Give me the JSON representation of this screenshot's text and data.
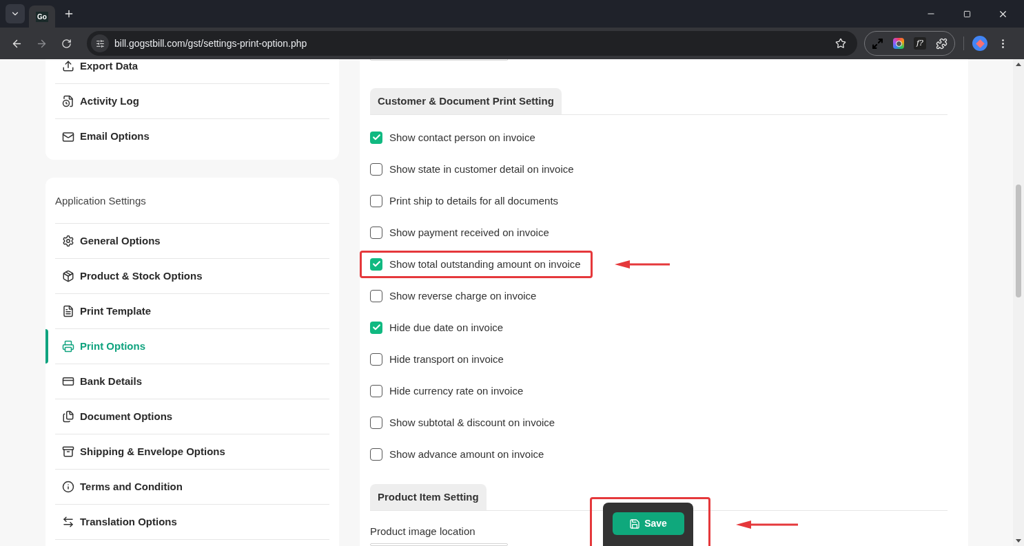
{
  "browser": {
    "tab_favicon": "Go",
    "url": "bill.gogstbill.com/gst/settings-print-option.php",
    "extension_label": "f?"
  },
  "sidebar": {
    "top_items": [
      {
        "label": "Export Data"
      },
      {
        "label": "Activity Log"
      },
      {
        "label": "Email Options"
      }
    ],
    "title": "Application Settings",
    "items": [
      {
        "label": "General Options",
        "selected": false
      },
      {
        "label": "Product & Stock Options",
        "selected": false
      },
      {
        "label": "Print Template",
        "selected": false
      },
      {
        "label": "Print Options",
        "selected": true
      },
      {
        "label": "Bank Details",
        "selected": false
      },
      {
        "label": "Document Options",
        "selected": false
      },
      {
        "label": "Shipping & Envelope Options",
        "selected": false
      },
      {
        "label": "Terms and Condition",
        "selected": false
      },
      {
        "label": "Translation Options",
        "selected": false
      }
    ]
  },
  "main": {
    "section_title": "Customer & Document Print Setting",
    "options": [
      {
        "label": "Show contact person on invoice",
        "checked": true,
        "highlighted": false
      },
      {
        "label": "Show state in customer detail on invoice",
        "checked": false,
        "highlighted": false
      },
      {
        "label": "Print ship to details for all documents",
        "checked": false,
        "highlighted": false
      },
      {
        "label": "Show payment received on invoice",
        "checked": false,
        "highlighted": false
      },
      {
        "label": "Show total outstanding amount on invoice",
        "checked": true,
        "highlighted": true
      },
      {
        "label": "Show reverse charge on invoice",
        "checked": false,
        "highlighted": false
      },
      {
        "label": "Hide due date on invoice",
        "checked": true,
        "highlighted": false
      },
      {
        "label": "Hide transport on invoice",
        "checked": false,
        "highlighted": false
      },
      {
        "label": "Hide currency rate on invoice",
        "checked": false,
        "highlighted": false
      },
      {
        "label": "Show subtotal & discount on invoice",
        "checked": false,
        "highlighted": false
      },
      {
        "label": "Show advance amount on invoice",
        "checked": false,
        "highlighted": false
      }
    ],
    "section2_title": "Product Item Setting",
    "field_label": "Product image location"
  },
  "save_button": {
    "label": "Save",
    "highlighted": true
  }
}
